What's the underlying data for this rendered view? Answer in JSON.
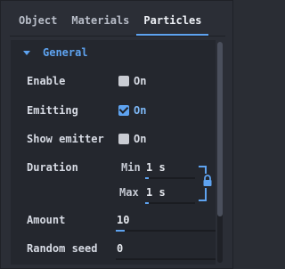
{
  "tabs": [
    {
      "label": "Object",
      "active": false
    },
    {
      "label": "Materials",
      "active": false
    },
    {
      "label": "Particles",
      "active": true
    }
  ],
  "section": {
    "title": "General",
    "expanded": true
  },
  "properties": {
    "enable": {
      "label": "Enable",
      "checked": false,
      "text": "On"
    },
    "emitting": {
      "label": "Emitting",
      "checked": true,
      "text": "On"
    },
    "show_emitter": {
      "label": "Show emitter",
      "checked": false,
      "text": "On"
    },
    "duration": {
      "label": "Duration",
      "min_label": "Min",
      "min_value": "1 s",
      "max_label": "Max",
      "max_value": "1 s",
      "linked": true
    },
    "amount": {
      "label": "Amount",
      "value": "10"
    },
    "random_seed": {
      "label": "Random seed",
      "value": "0"
    }
  },
  "colors": {
    "accent": "#5ea3f0",
    "background": "#2b2e36",
    "content_background": "#24272e",
    "text": "#d6dae3"
  },
  "icons": {
    "section_toggle": "triangle-down-icon",
    "link": "lock-icon"
  }
}
